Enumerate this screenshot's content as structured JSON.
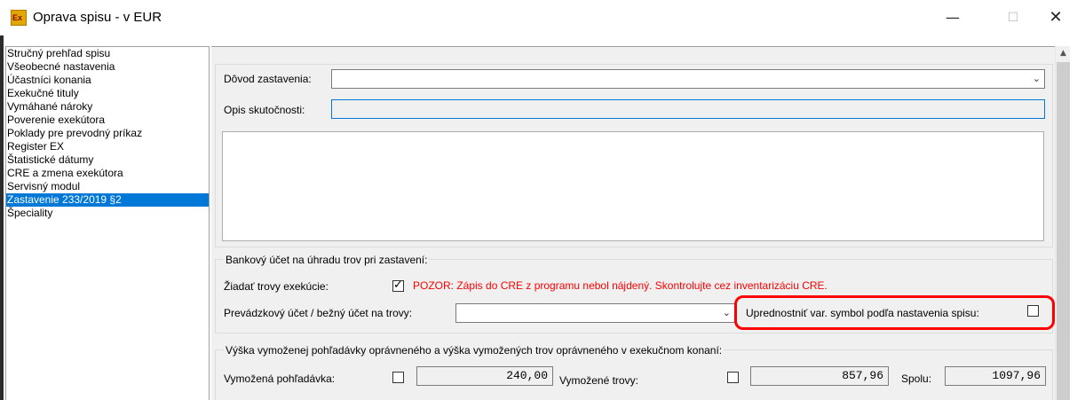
{
  "window": {
    "title": "Oprava spisu - v EUR",
    "icon_label": "Ex",
    "controls": {
      "minimize": "—",
      "maximize": "☐",
      "close": "✕"
    }
  },
  "nav": {
    "selected_index": 11,
    "items": [
      "Stručný prehľad spisu",
      "Všeobecné nastavenia",
      "Účastníci konania",
      "Exekučné tituly",
      "Vymáhané nároky",
      "Poverenie exekútora",
      "Poklady pre prevodný príkaz",
      "Register EX",
      "Štatistické dátumy",
      "CRE a zmena exekútora",
      "Servisný modul",
      "Zastavenie 233/2019 §2",
      "Špeciality"
    ]
  },
  "form": {
    "dovod_label": "Dôvod zastavenia:",
    "dovod_value": "",
    "opis_label": "Opis skutočnosti:",
    "opis_value": "",
    "memo_value": "",
    "bank": {
      "group_label": "Bankový účet na úhradu trov pri zastavení:",
      "ziadat_label": "Žiadať trovy exekúcie:",
      "ziadat_checked": true,
      "warning": "POZOR: Zápis do CRE z programu nebol nájdený. Skontrolujte cez inventarizáciu CRE.",
      "prevadzkovy_label": "Prevádzkový účet / bežný účet na trovy:",
      "prevadzkovy_value": "",
      "uprednostnit_label": "Uprednostniť var. symbol podľa nastavenia spisu:",
      "uprednostnit_checked": false
    },
    "amounts": {
      "group_label": "Výška vymoženej pohľadávky oprávneného a výška vymožených trov oprávneného v exekučnom konaní:",
      "vymozena_label": "Vymožená pohľadávka:",
      "vymozena_checked": false,
      "vymozena_value": "240,00",
      "trovy_label": "Vymožené trovy:",
      "trovy_checked": false,
      "trovy_value": "857,96",
      "spolu_label": "Spolu:",
      "spolu_value": "1097,96"
    }
  },
  "colors": {
    "selection": "#0078d7",
    "warning": "#ff0000",
    "highlight": "#ff0000",
    "panel_bg": "#f0f0f0"
  },
  "icons": {
    "dropdown": "chevron-down-icon",
    "scroll_up": "scroll-up-icon"
  }
}
